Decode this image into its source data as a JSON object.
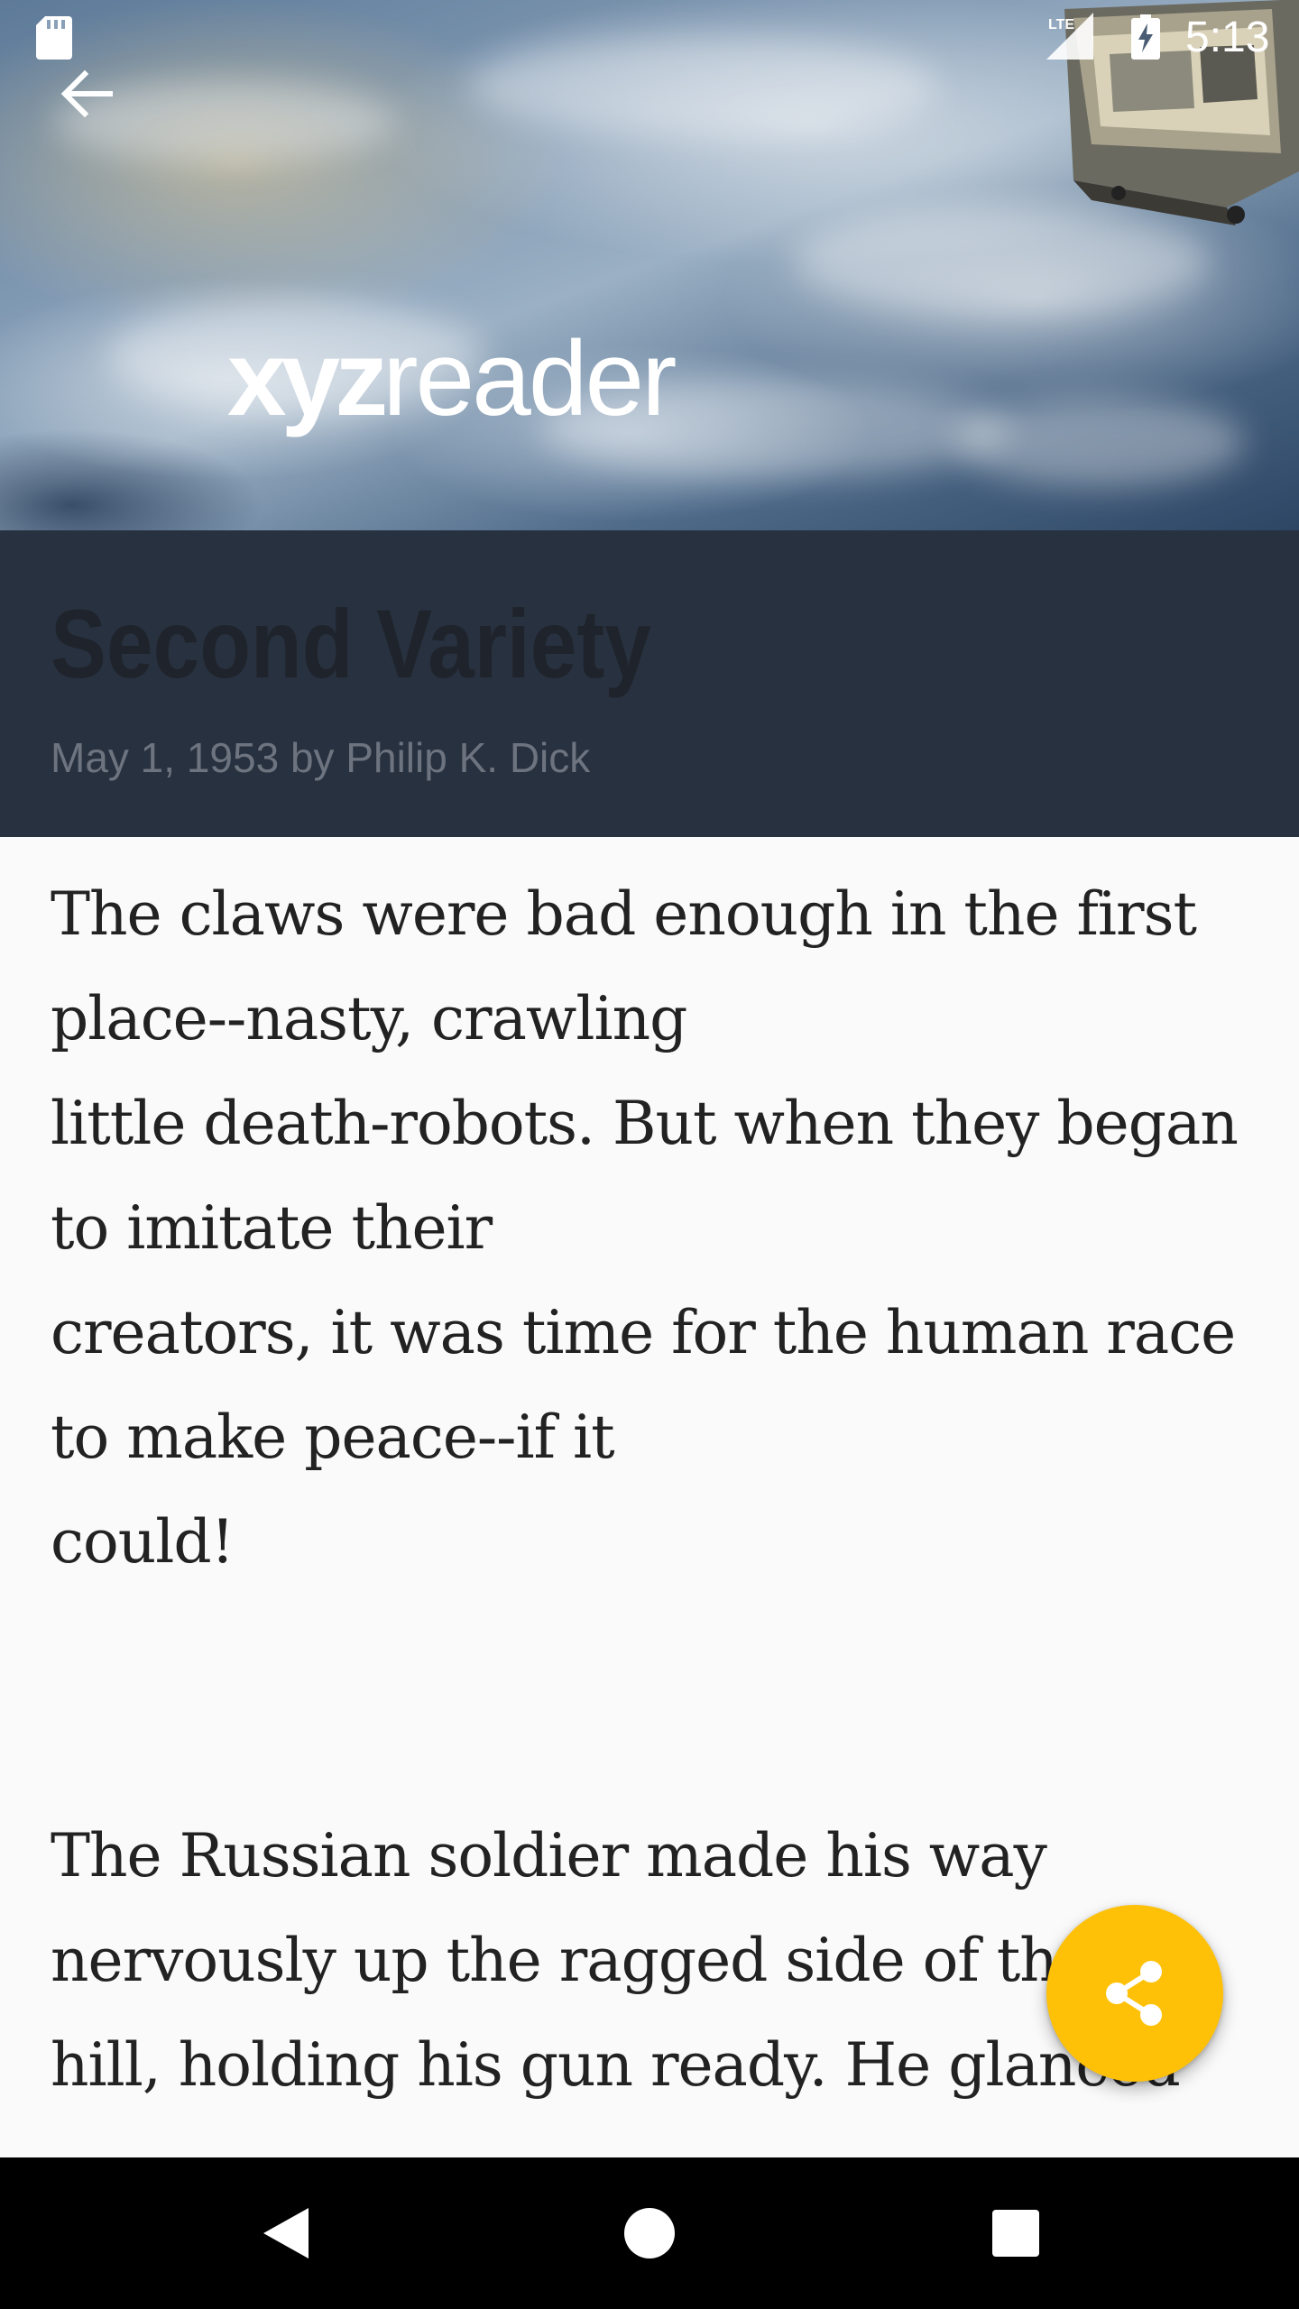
{
  "status_bar": {
    "time": "5:13",
    "network_label": "LTE",
    "icons": [
      "sd-card-icon",
      "lte-signal-icon",
      "battery-charging-icon"
    ]
  },
  "toolbar": {
    "back_icon": "arrow-back-icon"
  },
  "hero": {
    "logo_bold": "xyz",
    "logo_light": "reader"
  },
  "article": {
    "title": "Second Variety",
    "byline": "May 1, 1953 by Philip K. Dick",
    "paragraphs": [
      {
        "lines": [
          "The claws were bad enough in the first",
          "place--nasty, crawling",
          "little death-robots. But when they began",
          "to imitate their",
          "creators, it was time for the human race",
          "to make peace--if it",
          "could!"
        ]
      },
      {
        "lines": [
          "The Russian soldier made his way",
          "nervously up the ragged side of the",
          "hill, holding his gun ready. He glanced"
        ]
      }
    ]
  },
  "fab": {
    "icon": "share-icon"
  },
  "nav_bar": {
    "icons": [
      "back-triangle-icon",
      "home-circle-icon",
      "recents-square-icon"
    ]
  },
  "colors": {
    "title_band": "#28313f",
    "title_text": "#1f242c",
    "byline_text": "#6d7480",
    "body_text": "#222222",
    "background": "#fafafa",
    "fab": "#ffc107"
  }
}
